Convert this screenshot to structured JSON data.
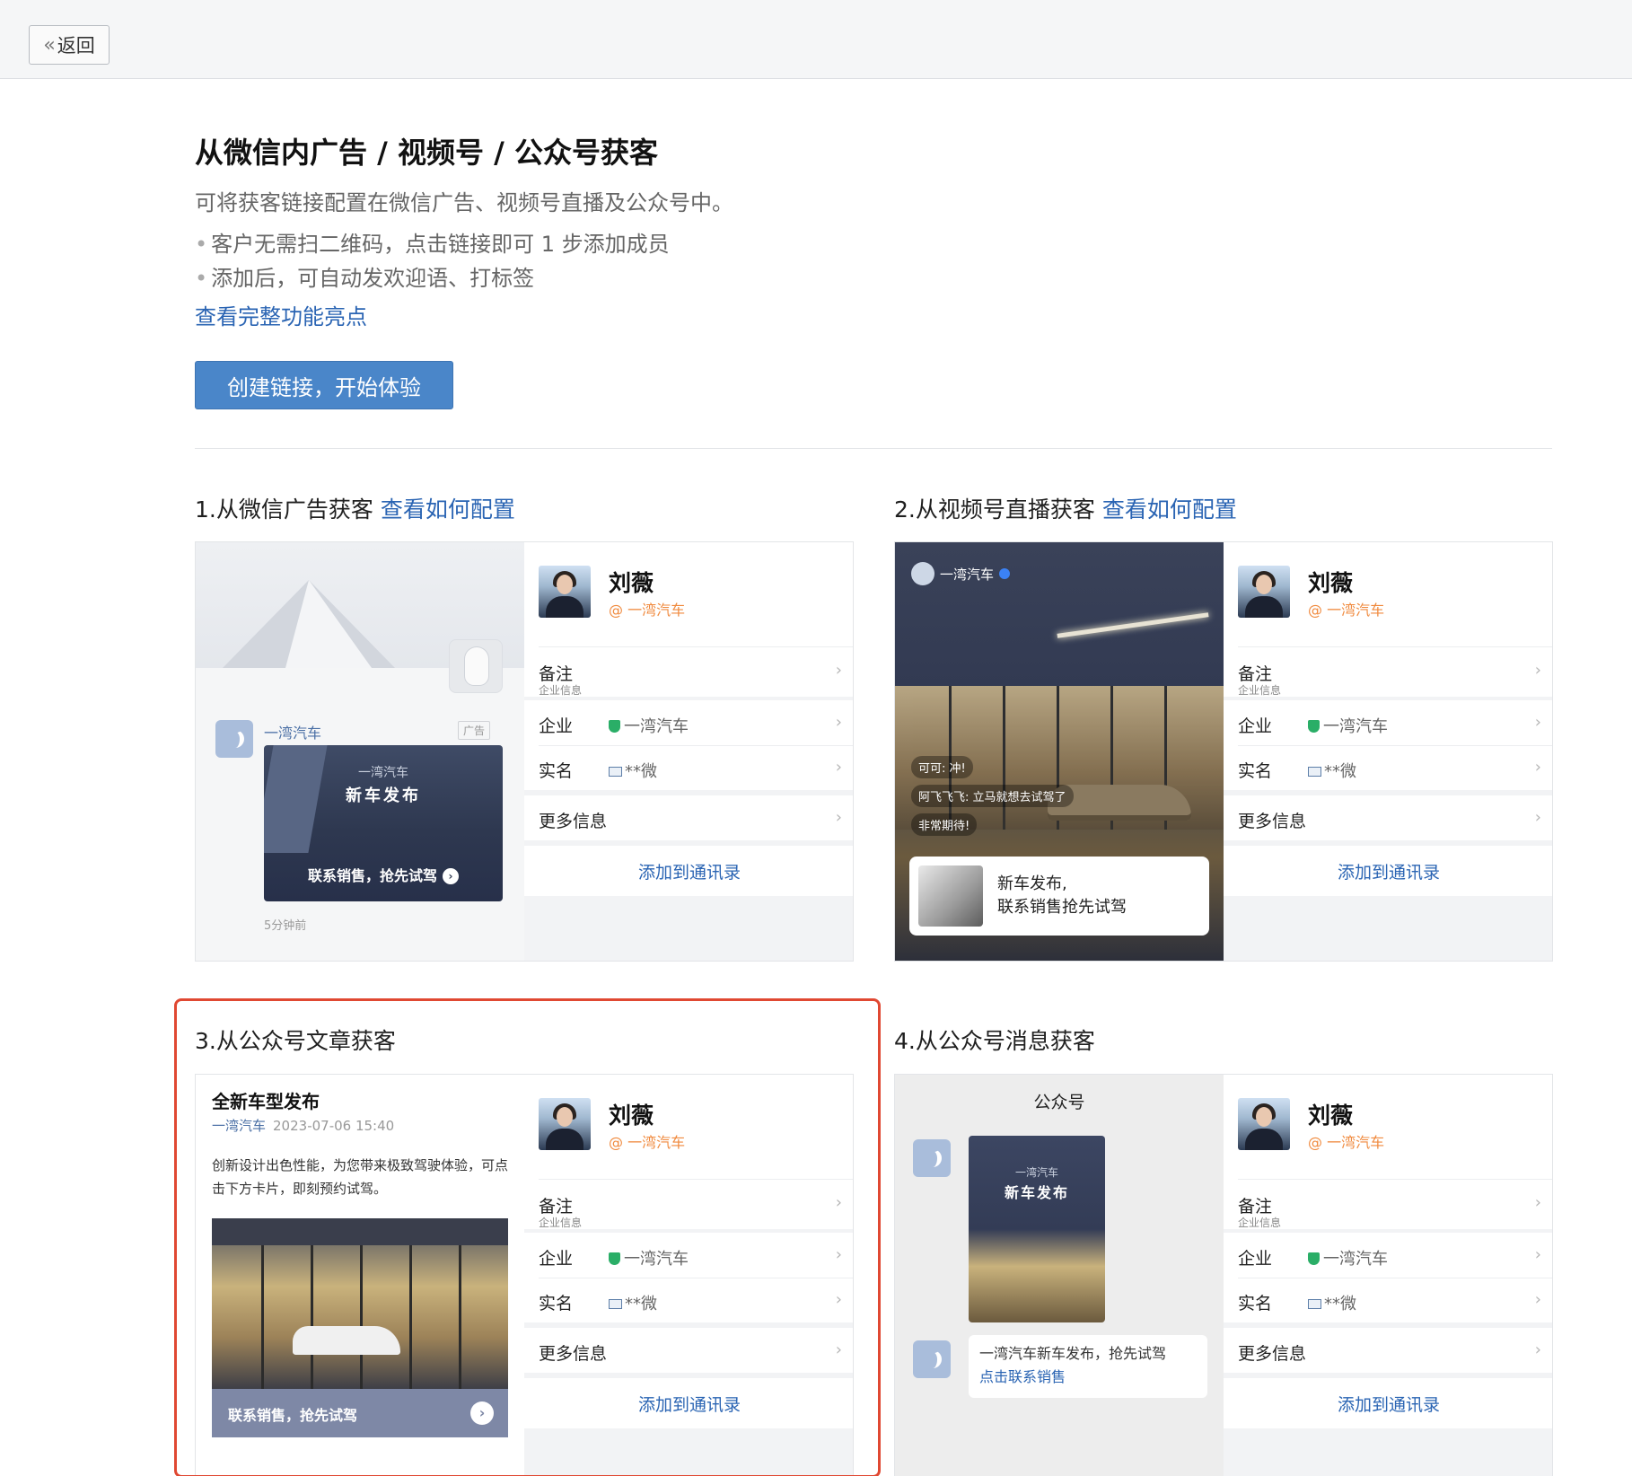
{
  "topbar": {
    "back_label": "返回"
  },
  "intro": {
    "title": "从微信内广告 / 视频号 / 公众号获客",
    "subtitle": "可将获客链接配置在微信广告、视频号直播及公众号中。",
    "bullets": [
      "客户无需扫二维码，点击链接即可 1 步添加成员",
      "添加后，可自动发欢迎语、打标签"
    ],
    "features_link": "查看完整功能亮点",
    "cta": "创建链接，开始体验"
  },
  "sections": [
    {
      "title": "1.从微信广告获客",
      "link": "查看如何配置"
    },
    {
      "title": "2.从视频号直播获客",
      "link": "查看如何配置"
    },
    {
      "title": "3.从公众号文章获客"
    },
    {
      "title": "4.从公众号消息获客"
    }
  ],
  "profile": {
    "name": "刘薇",
    "org": "@ 一湾汽车",
    "remark_label": "备注",
    "enterprise_section": "企业信息",
    "enterprise_label": "企业",
    "enterprise_value": "一湾汽车",
    "realname_label": "实名",
    "realname_value": "**微",
    "more_label": "更多信息",
    "add_contact": "添加到通讯录",
    "arrow": "›"
  },
  "ad": {
    "brand": "一湾汽车",
    "tag": "广告",
    "img_sub": "一湾汽车",
    "img_title": "新车发布",
    "img_cta": "联系销售，抢先试驾",
    "time": "5分钟前"
  },
  "live": {
    "account": "一湾汽车",
    "comments": [
      "可可: 冲!",
      "阿飞飞飞: 立马就想去试驾了",
      "非常期待!"
    ],
    "card_line1": "新车发布,",
    "card_line2": "联系销售抢先试驾"
  },
  "article": {
    "title": "全新车型发布",
    "account": "一湾汽车",
    "datetime": "2023-07-06 15:40",
    "body": "创新设计出色性能，为您带来极致驾驶体验，可点击下方卡片，即刻预约试驾。",
    "cta": "联系销售，抢先试驾"
  },
  "message": {
    "header": "公众号",
    "img_sub": "一湾汽车",
    "img_title": "新车发布",
    "bubble_text": "一湾汽车新车发布，抢先试驾",
    "bubble_link": "点击联系销售"
  },
  "colors": {
    "primary": "#4a86c9",
    "link": "#2a64b3",
    "highlight": "#e04832",
    "org": "#f08a3e"
  }
}
